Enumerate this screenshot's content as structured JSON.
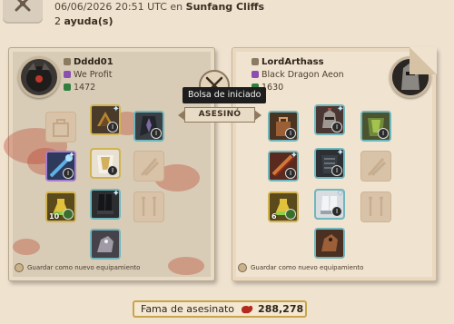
{
  "header": {
    "datetime": "06/06/2026 20:51 UTC",
    "connector": "en",
    "location": "Sunfang Cliffs",
    "assists_count": "2",
    "assists_label": "ayuda(s)"
  },
  "victim": {
    "name": "Dddd01",
    "guild": "We Profit",
    "item_power": "1472",
    "save_label": "Guardar como nuevo equipamiento"
  },
  "killer": {
    "name": "LordArthass",
    "guild": "Black Dragon Aeon",
    "item_power": "1630",
    "save_label": "Guardar como nuevo equipamiento"
  },
  "center": {
    "tooltip": "Bolsa de iniciado",
    "result_label": "ASESINÓ"
  },
  "equipment_badges": {
    "victim": {
      "bag": "I",
      "head": "I",
      "cape": "",
      "weapon": "I",
      "chest": "I",
      "offhand": "",
      "potion_stack": "10",
      "boots": "",
      "mount": ""
    },
    "killer": {
      "bag": "I",
      "head": "I",
      "cape": "I",
      "weapon": "I",
      "chest": "I",
      "offhand": "",
      "potion_stack": "6",
      "boots": "I",
      "mount": ""
    }
  },
  "fame": {
    "label": "Fama de asesinato",
    "value": "288,278"
  },
  "colors": {
    "background": "#efe2cf",
    "victim_panel": "#d8ccb6",
    "killer_panel": "#f0e3cf",
    "uncommon_border": "#6fb7bd",
    "rare_border": "#a57ed0",
    "gold_border": "#d1b352",
    "fame_border": "#c8a44c",
    "blood": "#b93c28"
  }
}
